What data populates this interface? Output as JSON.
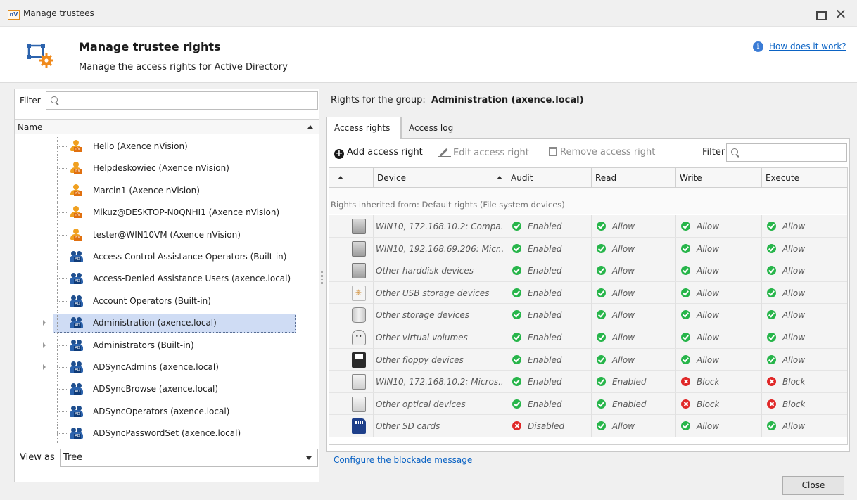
{
  "window": {
    "logo_text": "nV",
    "title": "Manage trustees"
  },
  "header": {
    "title": "Manage trustee rights",
    "subtitle": "Manage the access rights for Active Directory",
    "help_link": "How does it work?"
  },
  "left": {
    "filter_label": "Filter",
    "filter_value": "",
    "column_name": "Name",
    "tree_items": [
      {
        "label": "Hello (Axence nVision)",
        "type": "user",
        "expandable": false,
        "selected": false
      },
      {
        "label": "Helpdeskowiec (Axence nVision)",
        "type": "user",
        "expandable": false,
        "selected": false
      },
      {
        "label": "Marcin1 (Axence nVision)",
        "type": "user",
        "expandable": false,
        "selected": false
      },
      {
        "label": "Mikuz@DESKTOP-N0QNHI1 (Axence nVision)",
        "type": "user",
        "expandable": false,
        "selected": false
      },
      {
        "label": "tester@WIN10VM (Axence nVision)",
        "type": "user",
        "expandable": false,
        "selected": false
      },
      {
        "label": "Access Control Assistance Operators (Built-in)",
        "type": "group",
        "expandable": false,
        "selected": false
      },
      {
        "label": "Access-Denied Assistance Users (axence.local)",
        "type": "group",
        "expandable": false,
        "selected": false
      },
      {
        "label": "Account Operators (Built-in)",
        "type": "group",
        "expandable": false,
        "selected": false
      },
      {
        "label": "Administration (axence.local)",
        "type": "group",
        "expandable": true,
        "selected": true
      },
      {
        "label": "Administrators (Built-in)",
        "type": "group",
        "expandable": true,
        "selected": false
      },
      {
        "label": "ADSyncAdmins (axence.local)",
        "type": "group",
        "expandable": true,
        "selected": false
      },
      {
        "label": "ADSyncBrowse (axence.local)",
        "type": "group",
        "expandable": false,
        "selected": false
      },
      {
        "label": "ADSyncOperators (axence.local)",
        "type": "group",
        "expandable": false,
        "selected": false
      },
      {
        "label": "ADSyncPasswordSet (axence.local)",
        "type": "group",
        "expandable": false,
        "selected": false
      }
    ],
    "view_as_label": "View as",
    "view_as_value": "Tree"
  },
  "right": {
    "rights_for_label": "Rights for the group:",
    "group_name": "Administration (axence.local)",
    "tabs": [
      "Access rights",
      "Access log"
    ],
    "toolbar": {
      "add": "Add access right",
      "edit": "Edit access right",
      "remove": "Remove access right",
      "filter_label": "Filter",
      "filter_value": ""
    },
    "columns": [
      "Device",
      "Audit",
      "Read",
      "Write",
      "Execute"
    ],
    "group_banner": "Rights inherited from: Default rights (File system devices)",
    "rows": [
      {
        "icon": "harddisk-icon",
        "device": "WIN10, 172.168.10.2: Compa...",
        "audit": "Enabled",
        "read": "Allow",
        "write": "Allow",
        "execute": "Allow",
        "audit_ok": true,
        "read_ok": true,
        "write_ok": true,
        "execute_ok": true
      },
      {
        "icon": "harddisk-icon",
        "device": "WIN10, 192.168.69.206: Micr...",
        "audit": "Enabled",
        "read": "Allow",
        "write": "Allow",
        "execute": "Allow",
        "audit_ok": true,
        "read_ok": true,
        "write_ok": true,
        "execute_ok": true
      },
      {
        "icon": "harddisk-icon",
        "device": "Other harddisk devices",
        "audit": "Enabled",
        "read": "Allow",
        "write": "Allow",
        "execute": "Allow",
        "audit_ok": true,
        "read_ok": true,
        "write_ok": true,
        "execute_ok": true
      },
      {
        "icon": "usb-storage-icon",
        "device": "Other USB storage devices",
        "audit": "Enabled",
        "read": "Allow",
        "write": "Allow",
        "execute": "Allow",
        "audit_ok": true,
        "read_ok": true,
        "write_ok": true,
        "execute_ok": true
      },
      {
        "icon": "storage-icon",
        "device": "Other storage devices",
        "audit": "Enabled",
        "read": "Allow",
        "write": "Allow",
        "execute": "Allow",
        "audit_ok": true,
        "read_ok": true,
        "write_ok": true,
        "execute_ok": true
      },
      {
        "icon": "virtual-volume-icon",
        "device": "Other virtual volumes",
        "audit": "Enabled",
        "read": "Allow",
        "write": "Allow",
        "execute": "Allow",
        "audit_ok": true,
        "read_ok": true,
        "write_ok": true,
        "execute_ok": true
      },
      {
        "icon": "floppy-icon",
        "device": "Other floppy devices",
        "audit": "Enabled",
        "read": "Allow",
        "write": "Allow",
        "execute": "Allow",
        "audit_ok": true,
        "read_ok": true,
        "write_ok": true,
        "execute_ok": true
      },
      {
        "icon": "optical-drive-icon",
        "device": "WIN10, 172.168.10.2: Micros...",
        "audit": "Enabled",
        "read": "Enabled",
        "write": "Block",
        "execute": "Block",
        "audit_ok": true,
        "read_ok": true,
        "write_ok": false,
        "execute_ok": false
      },
      {
        "icon": "optical-drive-icon",
        "device": "Other optical devices",
        "audit": "Enabled",
        "read": "Enabled",
        "write": "Block",
        "execute": "Block",
        "audit_ok": true,
        "read_ok": true,
        "write_ok": false,
        "execute_ok": false
      },
      {
        "icon": "sd-card-icon",
        "device": "Other SD cards",
        "audit": "Disabled",
        "read": "Allow",
        "write": "Allow",
        "execute": "Allow",
        "audit_ok": false,
        "read_ok": true,
        "write_ok": true,
        "execute_ok": true
      }
    ],
    "configure_link": "Configure the blockade message"
  },
  "footer": {
    "close_label": "Close"
  }
}
